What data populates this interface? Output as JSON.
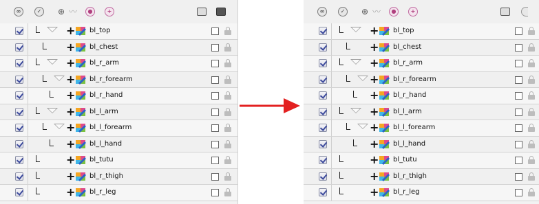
{
  "toolbar_icons": [
    "enable-all-icon",
    "disable-all-icon",
    "add-peg-icon",
    "inactive-icon",
    "layer-color-icon",
    "add-layer-icon",
    "display-icon",
    "lock-all-icon"
  ],
  "accent_colors": {
    "arrow": "#e32020",
    "checkbox_mark": "#3c4a9c"
  },
  "left_panel": {
    "layers": [
      {
        "name": "bl_top",
        "depth": 1,
        "expand": true,
        "checked": true
      },
      {
        "name": "bl_chest",
        "depth": 2,
        "expand": false,
        "checked": true
      },
      {
        "name": "bl_r_arm",
        "depth": 1,
        "expand": true,
        "checked": true
      },
      {
        "name": "bl_r_forearm",
        "depth": 2,
        "expand": true,
        "checked": true
      },
      {
        "name": "bl_r_hand",
        "depth": 3,
        "expand": false,
        "checked": true
      },
      {
        "name": "bl_l_arm",
        "depth": 1,
        "expand": true,
        "checked": true
      },
      {
        "name": "bl_l_forearm",
        "depth": 2,
        "expand": true,
        "checked": true
      },
      {
        "name": "bl_l_hand",
        "depth": 3,
        "expand": false,
        "checked": true
      },
      {
        "name": "bl_tutu",
        "depth": 1,
        "expand": false,
        "checked": true
      },
      {
        "name": "bl_r_thigh",
        "depth": 1,
        "expand": false,
        "checked": true
      },
      {
        "name": "bl_r_leg",
        "depth": 1,
        "expand": false,
        "checked": true
      }
    ]
  },
  "right_panel": {
    "layers": [
      {
        "name": "bl_top",
        "depth": 1,
        "expand": true,
        "checked": true
      },
      {
        "name": "bl_chest",
        "depth": 2,
        "expand": false,
        "checked": true
      },
      {
        "name": "bl_r_arm",
        "depth": 1,
        "expand": true,
        "checked": true
      },
      {
        "name": "bl_r_forearm",
        "depth": 2,
        "expand": true,
        "checked": true
      },
      {
        "name": "bl_r_hand",
        "depth": 3,
        "expand": false,
        "checked": true
      },
      {
        "name": "bl_l_arm",
        "depth": 1,
        "expand": true,
        "checked": true
      },
      {
        "name": "bl_l_forearm",
        "depth": 2,
        "expand": true,
        "checked": true
      },
      {
        "name": "bl_l_hand",
        "depth": 3,
        "expand": false,
        "checked": true
      },
      {
        "name": "bl_tutu",
        "depth": 1,
        "expand": false,
        "checked": true
      },
      {
        "name": "bl_r_thigh",
        "depth": 1,
        "expand": false,
        "checked": true
      },
      {
        "name": "bl_r_leg",
        "depth": 1,
        "expand": false,
        "checked": true
      }
    ]
  }
}
